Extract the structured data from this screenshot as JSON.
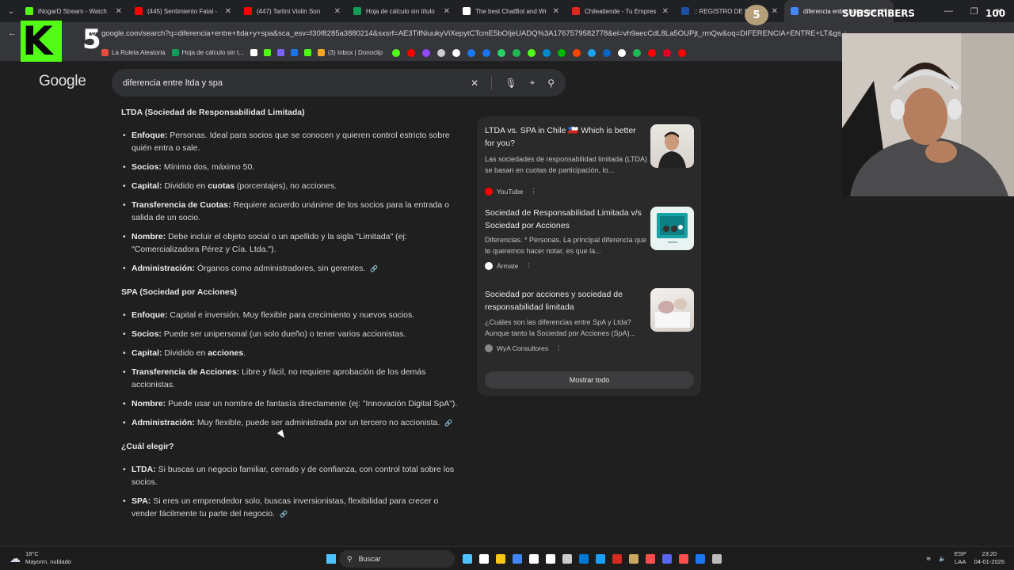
{
  "browser": {
    "tabs": [
      {
        "title": "iNogarD Stream - Watch",
        "color": "#53fc18"
      },
      {
        "title": "(445) Sentimiento Fatal -",
        "color": "#ff0000"
      },
      {
        "title": "(447) Tartini Violin Son",
        "color": "#ff0000"
      },
      {
        "title": "Hoja de cálculo sin título",
        "color": "#0f9d58"
      },
      {
        "title": "The best ChatBot and Wr",
        "color": "#ffffff"
      },
      {
        "title": "Chileatiende - Tu Empres",
        "color": "#d52b1e"
      },
      {
        "title": ":: REGISTRO DE EMPRESAS",
        "color": "#1a4fa3"
      },
      {
        "title": "diferencia entre ltda y spa",
        "color": "#4285f4",
        "active": true
      }
    ],
    "url": "google.com/search?q=diferencia+entre+ltda+y+spa&sca_esv=f30f8285a3880214&sxsrf=AE3TifNiuukyViXepytCTcmE5bOIjeUADQ%3A1767579582778&ei=vh9aecCdL8La5OUPjt_rmQw&oq=DIFERENCIA+ENTRE+LT&gs_lp=Eg...",
    "bookmarks": [
      {
        "label": "La Ruleta Aleatoria",
        "color": "#e74c3c"
      },
      {
        "label": "Hoja de cálculo sin t...",
        "color": "#0f9d58"
      },
      {
        "label": "",
        "color": "#ffffff"
      },
      {
        "label": "",
        "color": "#53fc18"
      },
      {
        "label": "",
        "color": "#7b61ff"
      },
      {
        "label": "",
        "color": "#1a73e8"
      },
      {
        "label": "",
        "color": "#53fc18"
      },
      {
        "label": "(3) Inbox | Donoclip",
        "color": "#f5a623"
      }
    ],
    "bookmark_icons": [
      "#53fc18",
      "#ff0000",
      "#9146ff",
      "#cccccc",
      "#ffffff",
      "#1877f2",
      "#1a73e8",
      "#25d366",
      "#1db954",
      "#53fc18",
      "#0088cc",
      "#00b900",
      "#ff4500",
      "#1da1f2",
      "#0a66c2",
      "#ffffff",
      "#1db954",
      "#ff0000",
      "#e60023",
      "#ff0000"
    ]
  },
  "overlay": {
    "kick_logo_letter": "K",
    "kick_count": "5",
    "subscribers_label": "SUBSCRIBERS",
    "subscribers_count": "100",
    "badge_number": "5"
  },
  "google": {
    "logo": "Google",
    "query": "diferencia entre ltda y spa"
  },
  "answer": {
    "ltda_heading": "LTDA (Sociedad de Responsabilidad Limitada)",
    "ltda_items": [
      {
        "label": "Enfoque:",
        "text": " Personas. Ideal para socios que se conocen y quieren control estricto sobre quién entra o sale."
      },
      {
        "label": "Socios:",
        "text": " Mínimo dos, máximo 50."
      },
      {
        "label": "Capital:",
        "text": " Dividido en ",
        "bold2": "cuotas",
        "text2": " (porcentajes), no acciones."
      },
      {
        "label": "Transferencia de Cuotas:",
        "text": " Requiere acuerdo unánime de los socios para la entrada o salida de un socio."
      },
      {
        "label": "Nombre:",
        "text": " Debe incluir el objeto social o un apellido y la sigla \"Limitada\" (ej: \"Comercializadora Pérez y Cía. Ltda.\")."
      },
      {
        "label": "Administración:",
        "text": " Órganos como administradores, sin gerentes.",
        "link": true
      }
    ],
    "spa_heading": "SPA (Sociedad por Acciones)",
    "spa_items": [
      {
        "label": "Enfoque:",
        "text": " Capital e inversión. Muy flexible para crecimiento y nuevos socios."
      },
      {
        "label": "Socios:",
        "text": " Puede ser unipersonal (un solo dueño) o tener varios accionistas."
      },
      {
        "label": "Capital:",
        "text": " Dividido en ",
        "bold2": "acciones",
        "text2": "."
      },
      {
        "label": "Transferencia de Acciones:",
        "text": " Libre y fácil, no requiere aprobación de los demás accionistas."
      },
      {
        "label": "Nombre:",
        "text": " Puede usar un nombre de fantasía directamente (ej: \"Innovación Digital SpA\")."
      },
      {
        "label": "Administración:",
        "text": " Muy flexible, puede ser administrada por un tercero no accionista.",
        "link": true
      }
    ],
    "choose_heading": "¿Cuál elegir?",
    "choose_items": [
      {
        "label": "LTDA:",
        "text": " Si buscas un negocio familiar, cerrado y de confianza, con control total sobre los socios."
      },
      {
        "label": "SPA:",
        "text": " Si eres un emprendedor solo, buscas inversionistas, flexibilidad para crecer o vender fácilmente tu parte del negocio.",
        "link": true
      }
    ]
  },
  "sources": {
    "cards": [
      {
        "title": "LTDA vs. SPA in Chile 🇨🇱 Which is better for you?",
        "snippet": "Las sociedades de responsabilidad limitada (LTDA) se basan en cuotas de participación, lo...",
        "source": "YouTube",
        "source_color": "#ff0000"
      },
      {
        "title": "Sociedad de Responsabilidad Limitada v/s Sociedad por Acciones",
        "snippet": "Diferencias. * Personas. La principal diferencia que te queremos hacer notar, es que la...",
        "source": "Ármate",
        "source_color": "#ffffff"
      },
      {
        "title": "Sociedad por acciones y sociedad de responsabilidad limitada",
        "snippet": "¿Cuáles son las diferencias entre SpA y Ltda? Aunque tanto la Sociedad por Acciones (SpA)...",
        "source": "WyA Consultores",
        "source_color": "#888888"
      }
    ],
    "show_all": "Mostrar todo"
  },
  "taskbar": {
    "temp": "18°C",
    "weather": "Mayorm. nublado",
    "search_label": "Buscar",
    "lang_top": "ESP",
    "lang_bottom": "LAA",
    "time": "23:20",
    "date": "04-01-2026",
    "app_colors": [
      "#4cc2ff",
      "#ffffff",
      "#f5c518",
      "#4285f4",
      "#ffffff",
      "#ffffff",
      "#cccccc",
      "#0078d4",
      "#1a9fff",
      "#d52b1e",
      "#c8a860",
      "#ff4d4d",
      "#5865f2",
      "#ff4d4d",
      "#1877f2",
      "#bbbbbb"
    ]
  }
}
